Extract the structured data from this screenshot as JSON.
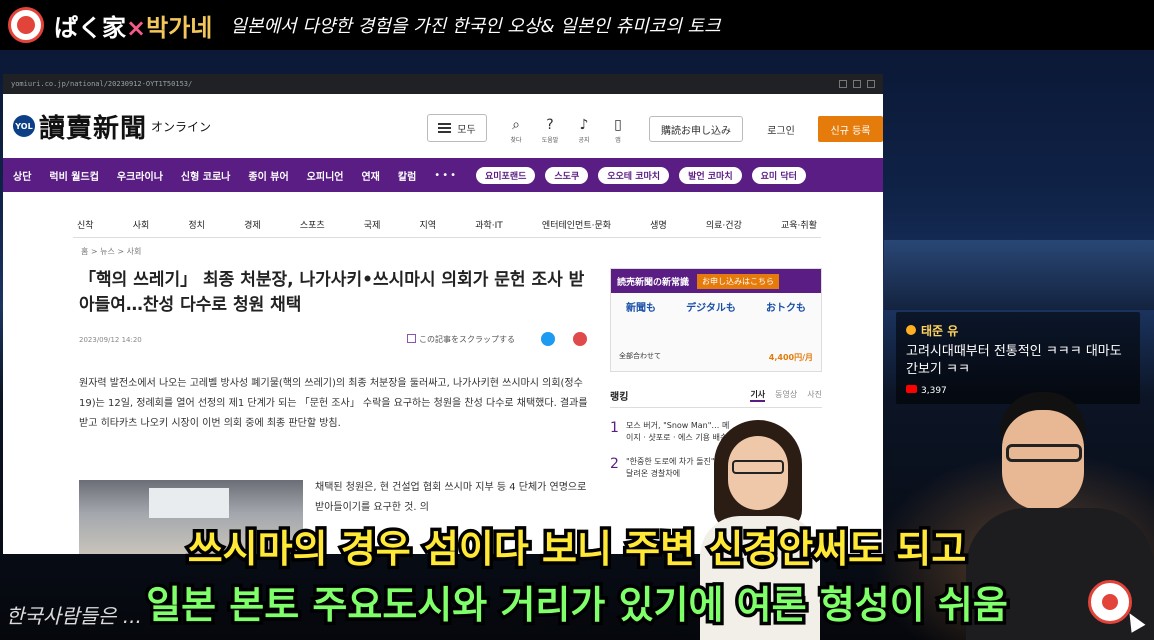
{
  "banner": {
    "name_jp": "ぱく家",
    "name_x": "×",
    "name_kr": "박가네",
    "subtitle": "일본에서 다양한 경험을 가진 한국인 오상& 일본인 츄미코의 토크"
  },
  "browser": {
    "url": "yomiuri.co.jp/national/20230912-OYT1T50153/"
  },
  "site": {
    "logo_badge": "YOL",
    "brand": "讀賣新聞",
    "brand_sub": "オンライン",
    "menu_label": "모두",
    "icons": [
      {
        "name": "search-icon",
        "glyph": "⌕",
        "label": "찾다"
      },
      {
        "name": "help-icon",
        "glyph": "?",
        "label": "도움말"
      },
      {
        "name": "bell-icon",
        "glyph": "♪",
        "label": "공지"
      },
      {
        "name": "phone-icon",
        "glyph": "▯",
        "label": "앱"
      }
    ],
    "subscribe": "購読お申し込み",
    "login": "로그인",
    "signup": "신규 등록"
  },
  "nav": {
    "items": [
      "상단",
      "럭비 월드컵",
      "우크라이나",
      "신형 코로나",
      "종이 뷰어",
      "오피니언",
      "연재",
      "칼럼"
    ],
    "more": "•••",
    "pills": [
      "요미포랜드",
      "스도쿠",
      "오오테 코마치",
      "발언 코마치",
      "요미 닥터"
    ]
  },
  "categories": [
    "신착",
    "사회",
    "정치",
    "경제",
    "스포츠",
    "국제",
    "지역",
    "과학·IT",
    "엔터테인먼트·문화",
    "생명",
    "의료·건강",
    "교육·취활"
  ],
  "breadcrumb": "홈 > 뉴스 > 사회",
  "article": {
    "headline": "「핵의 쓰레기」 최종 처분장, 나가사키•쓰시마시 의회가 문헌 조사 받아들여…찬성 다수로 청원 채택",
    "date": "2023/09/12 14:20",
    "clip_label": "この記事をスクラップする",
    "body1": "원자력 발전소에서 나오는 고레벨 방사성 폐기물(핵의 쓰레기)의 최종 처분장을 둘러싸고, 나가사키현 쓰시마시 의회(정수 19)는 12일, 정례회를 열어 선정의 제1 단계가 되는 「문헌 조사」 수락을 요구하는 청원을 찬성 다수로 채택했다. 결과를 받고 히타카츠 나오키 시장이 이번 의회 중에 최종 판단할 방침.",
    "body2": "채택된 청원은, 현 건설업 협회 쓰시마 지부 등 4 단체가 연명으로 받아들이기를 요구한 것. 의"
  },
  "ad": {
    "title": "読売新聞の新常識",
    "button": "お申し込みはこちら",
    "items": [
      "新聞も",
      "デジタルも",
      "おトクも"
    ],
    "footer": "全部合わせて",
    "price": "4,400円/月"
  },
  "ranking": {
    "title": "랭킹",
    "tabs": [
      "기사",
      "동영상",
      "사진"
    ],
    "items": [
      {
        "n": "1",
        "text": "모스 버거, \"Snow Man\"… 메이지 · 샷포로 · 에스 기용 배송"
      },
      {
        "n": "2",
        "text": "\"한중한 도로에 차가 돌진\" 동포, 달려온 경찰차에"
      }
    ]
  },
  "chat": {
    "user": "태준 유",
    "message": "고려시대때부터 전통적인 ㅋㅋㅋ 대마도 간보기 ㅋㅋ",
    "views": "3,397"
  },
  "captions": {
    "line1": "쓰시마의 경우 섬이다 보니 주변 신경안써도 되고",
    "line2": "일본 본토 주요도시와 거리가 있기에 여론 형성이 쉬움"
  },
  "bottom_text": "한국사람들은 ..."
}
